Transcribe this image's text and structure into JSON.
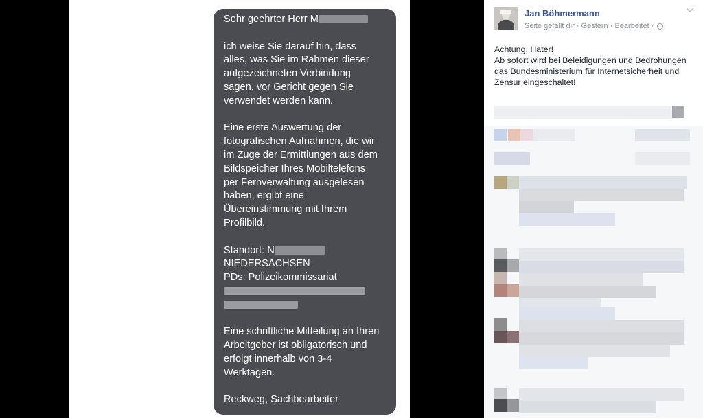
{
  "message": {
    "greeting": "Sehr geehrter Herr M",
    "para1": [
      "ich weise Sie darauf hin, dass",
      "alles, was Sie im Rahmen dieser",
      "aufgezeichneten Verbindung",
      "sagen, vor Gericht gegen Sie",
      "verwendet werden kann."
    ],
    "para2": [
      "Eine erste Auswertung der",
      "fotografischen Aufnahmen, die wir",
      "im Zuge der Ermittlungen aus dem",
      "Bildspeicher Ihres Mobiltelefons",
      "per Fernverwaltung ausgelesen",
      "haben, ergibt eine",
      "Übereinstimmung mit Ihrem",
      "Profilbild."
    ],
    "location_label": "Standort: N",
    "state": "NIEDERSACHSEN",
    "office": "PDs: Polizeikommissariat",
    "para4": [
      "Eine schriftliche Mitteilung an Ihren",
      "Arbeitgeber ist obligatorisch und",
      "erfolgt innerhalb von 3-4",
      "Werktagen."
    ],
    "signature": "Reckweg, Sachbearbeiter"
  },
  "post": {
    "author": "Jan Böhmermann",
    "meta": {
      "liked": "Seite gefällt dir",
      "time": "Gestern",
      "edited": "Bearbeitet"
    },
    "text": [
      "Achtung, Hater!",
      "Ab sofort wird bei Beleidigungen und Bedrohungen",
      "das Bundesministerium für Internetsicherheit und",
      "Zensur eingeschaltet!"
    ],
    "icons": {
      "chevron": "chevron-down-icon",
      "privacy": "globe-icon"
    }
  },
  "colors": {
    "bubble": "#4a4c52",
    "author_link": "#3b5998",
    "meta_text": "#90949c"
  }
}
